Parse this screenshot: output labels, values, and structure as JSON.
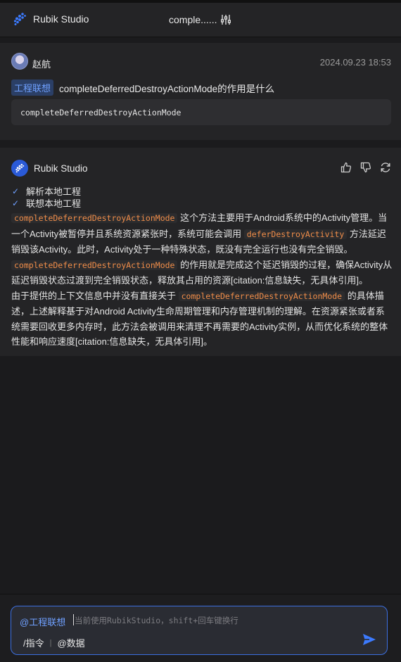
{
  "header": {
    "app_name": "Rubik Studio",
    "title": "comple......",
    "logo_icon": "rubik-logo-icon",
    "settings_icon": "sliders-icon"
  },
  "user_message": {
    "name": "赵航",
    "timestamp": "2024.09.23 18:53",
    "tag": "工程联想",
    "question": "completeDeferredDestroyActionMode的作用是什么",
    "code": "completeDeferredDestroyActionMode"
  },
  "bot_message": {
    "name": "Rubik Studio",
    "actions": [
      "thumbs-up-icon",
      "thumbs-down-icon",
      "refresh-icon"
    ],
    "steps": [
      "解析本地工程",
      "联想本地工程"
    ],
    "answer": {
      "p1_code": "completeDeferredDestroyActionMode",
      "p1_text_a": " 这个方法主要用于Android系统中的Activity管理。当一个Activity被暂停并且系统资源紧张时，系统可能会调用 ",
      "p1_code2": "deferDestroyActivity",
      "p1_text_b": " 方法延迟销毁该Activity。此时，Activity处于一种特殊状态，既没有完全运行也没有完全销毁。",
      "p2_code": "completeDeferredDestroyActionMode",
      "p2_text": " 的作用就是完成这个延迟销毁的过程，确保Activity从延迟销毁状态过渡到完全销毁状态，释放其占用的资源[citation:信息缺失，无具体引用]。",
      "p3_text_a": "由于提供的上下文信息中并没有直接关于 ",
      "p3_code": "completeDeferredDestroyActionMode",
      "p3_text_b": " 的具体描述，上述解释基于对Android Activity生命周期管理和内存管理机制的理解。在资源紧张或者系统需要回收更多内存时，此方法会被调用来清理不再需要的Activity实例，从而优化系统的整体性能和响应速度[citation:信息缺失，无具体引用]。"
    }
  },
  "input": {
    "context_tag": "@工程联想",
    "placeholder": "当前使用RubikStudio，shift+回车键换行",
    "command_label": "/指令",
    "data_label": "@数据",
    "send_icon": "send-icon"
  },
  "colors": {
    "accent": "#3c6fe0",
    "code_highlight": "#f08d49"
  }
}
